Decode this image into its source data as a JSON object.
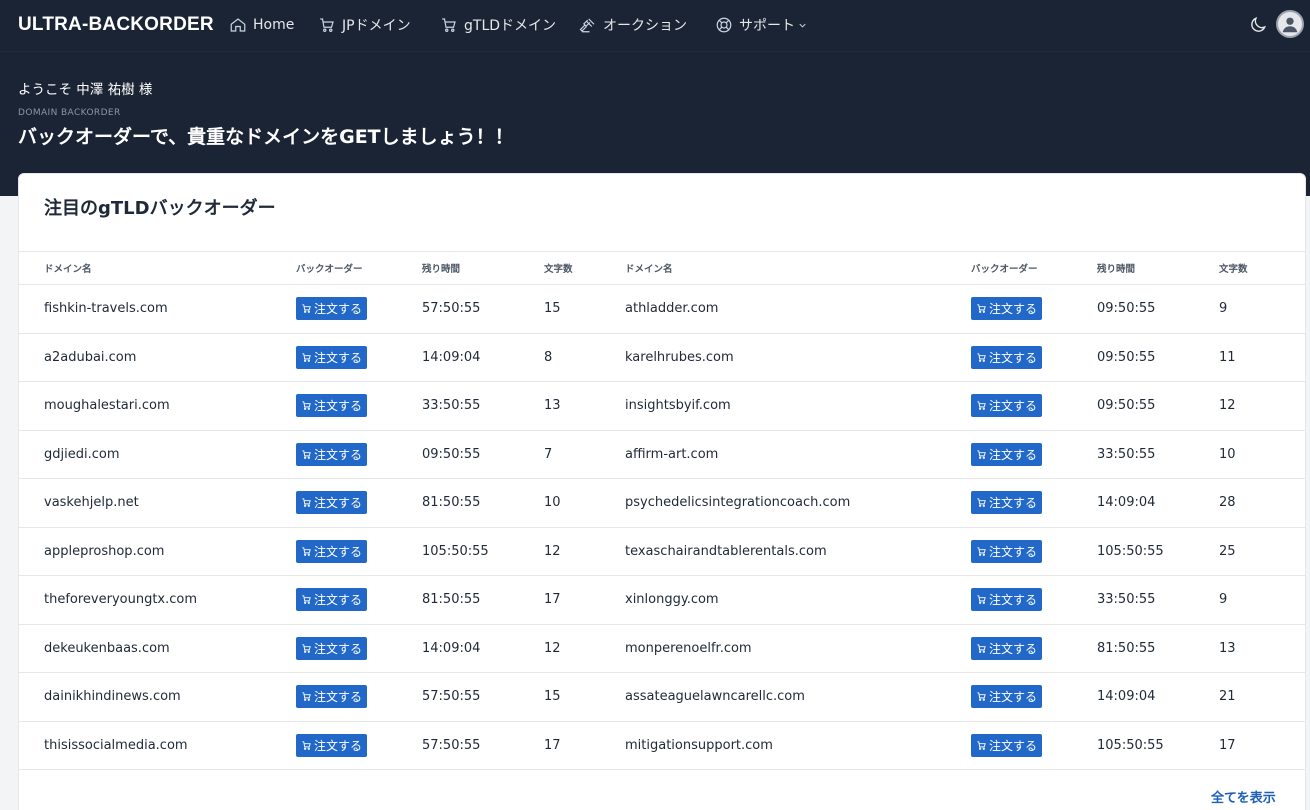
{
  "brand": "ULTRA-BACKORDER",
  "nav": {
    "home": "Home",
    "jp_domain": "JPドメイン",
    "gtld_domain": "gTLDドメイン",
    "auction": "オークション",
    "support": "サポート"
  },
  "hero": {
    "welcome": "ようこそ 中澤 祐樹 様",
    "eyebrow": "DOMAIN BACKORDER",
    "title": "バックオーダーで、貴重なドメインをGETしましょう！！"
  },
  "card": {
    "title": "注目のgTLDバックオーダー",
    "view_all": "全てを表示"
  },
  "table": {
    "headers": [
      "ドメイン名",
      "バックオーダー",
      "残り時間",
      "文字数",
      "ドメイン名",
      "バックオーダー",
      "残り時間",
      "文字数"
    ],
    "order_label": "注文する",
    "rows": [
      {
        "left": {
          "domain": "fishkin-travels.com",
          "time": "57:50:55",
          "chars": "15"
        },
        "right": {
          "domain": "athladder.com",
          "time": "09:50:55",
          "chars": "9"
        }
      },
      {
        "left": {
          "domain": "a2adubai.com",
          "time": "14:09:04",
          "chars": "8"
        },
        "right": {
          "domain": "karelhrubes.com",
          "time": "09:50:55",
          "chars": "11"
        }
      },
      {
        "left": {
          "domain": "moughalestari.com",
          "time": "33:50:55",
          "chars": "13"
        },
        "right": {
          "domain": "insightsbyif.com",
          "time": "09:50:55",
          "chars": "12"
        }
      },
      {
        "left": {
          "domain": "gdjiedi.com",
          "time": "09:50:55",
          "chars": "7"
        },
        "right": {
          "domain": "affirm-art.com",
          "time": "33:50:55",
          "chars": "10"
        }
      },
      {
        "left": {
          "domain": "vaskehjelp.net",
          "time": "81:50:55",
          "chars": "10"
        },
        "right": {
          "domain": "psychedelicsintegrationcoach.com",
          "time": "14:09:04",
          "chars": "28"
        }
      },
      {
        "left": {
          "domain": "appleproshop.com",
          "time": "105:50:55",
          "chars": "12"
        },
        "right": {
          "domain": "texaschairandtablerentals.com",
          "time": "105:50:55",
          "chars": "25"
        }
      },
      {
        "left": {
          "domain": "theforeveryoungtx.com",
          "time": "81:50:55",
          "chars": "17"
        },
        "right": {
          "domain": "xinlonggy.com",
          "time": "33:50:55",
          "chars": "9"
        }
      },
      {
        "left": {
          "domain": "dekeukenbaas.com",
          "time": "14:09:04",
          "chars": "12"
        },
        "right": {
          "domain": "monperenoelfr.com",
          "time": "81:50:55",
          "chars": "13"
        }
      },
      {
        "left": {
          "domain": "dainikhindinews.com",
          "time": "57:50:55",
          "chars": "15"
        },
        "right": {
          "domain": "assateaguelawncarellc.com",
          "time": "14:09:04",
          "chars": "21"
        }
      },
      {
        "left": {
          "domain": "thisissocialmedia.com",
          "time": "57:50:55",
          "chars": "17"
        },
        "right": {
          "domain": "mitigationsupport.com",
          "time": "105:50:55",
          "chars": "17"
        }
      }
    ]
  }
}
